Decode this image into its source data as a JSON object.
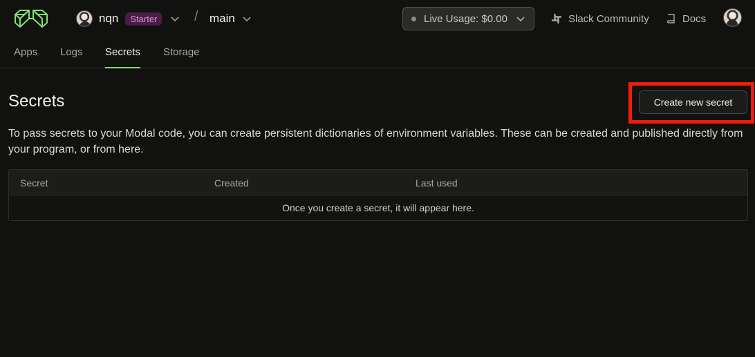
{
  "header": {
    "workspace_name": "nqn",
    "plan_badge": "Starter",
    "separator": "/",
    "environment": "main",
    "usage_label": "Live Usage: $0.00",
    "links": [
      {
        "label": "Slack Community",
        "icon": "slack-icon"
      },
      {
        "label": "Docs",
        "icon": "book-icon"
      }
    ]
  },
  "tabs": [
    {
      "label": "Apps",
      "active": false
    },
    {
      "label": "Logs",
      "active": false
    },
    {
      "label": "Secrets",
      "active": true
    },
    {
      "label": "Storage",
      "active": false
    }
  ],
  "main": {
    "title": "Secrets",
    "create_button_label": "Create new secret",
    "description": "To pass secrets to your Modal code, you can create persistent dictionaries of environment variables. These can be created and published directly from your program, or from here.",
    "table": {
      "columns": [
        "Secret",
        "Created",
        "Last used"
      ],
      "empty_message": "Once you create a secret, it will appear here."
    }
  },
  "colors": {
    "accent": "#7ee36b",
    "badge_bg": "#4a1d47",
    "badge_text": "#d98fd1",
    "highlight": "#f21d08",
    "background": "#111210"
  }
}
